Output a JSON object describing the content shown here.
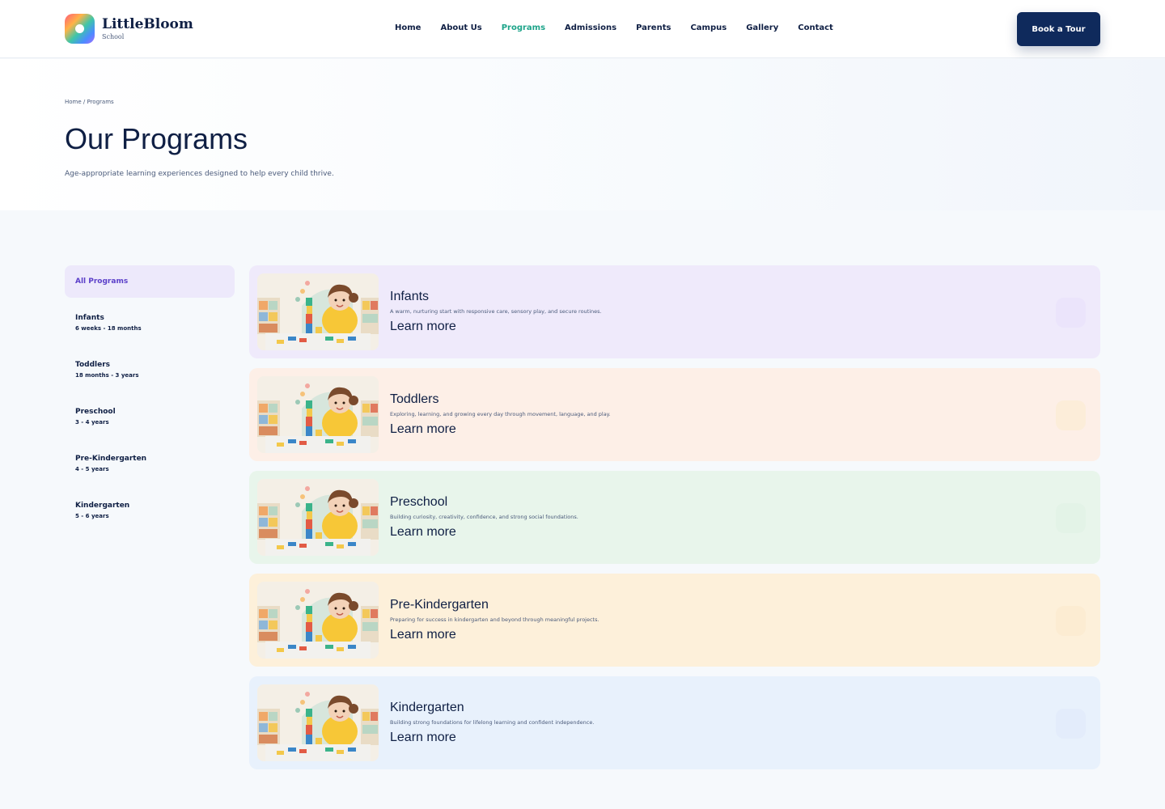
{
  "brand": {
    "name": "LittleBloom",
    "sub": "School"
  },
  "nav": {
    "items": [
      "Home",
      "About Us",
      "Programs",
      "Admissions",
      "Parents",
      "Campus",
      "Gallery",
      "Contact"
    ],
    "active": "Programs"
  },
  "header": {
    "cta_label": "Book a Tour"
  },
  "hero": {
    "breadcrumb": "Home / Programs",
    "title": "Our Programs",
    "subtitle": "Age-appropriate learning experiences designed to help every child thrive."
  },
  "sidebar": {
    "all_label": "All Programs",
    "items": [
      {
        "label": "Infants",
        "age": "6 weeks - 18 months"
      },
      {
        "label": "Toddlers",
        "age": "18 months - 3 years"
      },
      {
        "label": "Preschool",
        "age": "3 - 4 years"
      },
      {
        "label": "Pre-Kindergarten",
        "age": "4 - 5 years"
      },
      {
        "label": "Kindergarten",
        "age": "5 - 6 years"
      }
    ]
  },
  "programs": [
    {
      "title": "Infants",
      "desc": "A warm, nurturing start with responsive care, sensory play, and secure routines.",
      "link": "Learn more",
      "bg": "#efeafb",
      "badge": "#ebe4fb"
    },
    {
      "title": "Toddlers",
      "desc": "Exploring, learning, and growing every day through movement, language, and play.",
      "link": "Learn more",
      "bg": "#fdefe7",
      "badge": "#fcedd9"
    },
    {
      "title": "Preschool",
      "desc": "Building curiosity, creativity, confidence, and strong social foundations.",
      "link": "Learn more",
      "bg": "#e8f5eb",
      "badge": "#e3f3e7"
    },
    {
      "title": "Pre-Kindergarten",
      "desc": "Preparing for success in kindergarten and beyond through meaningful projects.",
      "link": "Learn more",
      "bg": "#fdf0da",
      "badge": "#fcecd2"
    },
    {
      "title": "Kindergarten",
      "desc": "Building strong foundations for lifelong learning and confident independence.",
      "link": "Learn more",
      "bg": "#e8f1fc",
      "badge": "#e3ecfb"
    }
  ]
}
